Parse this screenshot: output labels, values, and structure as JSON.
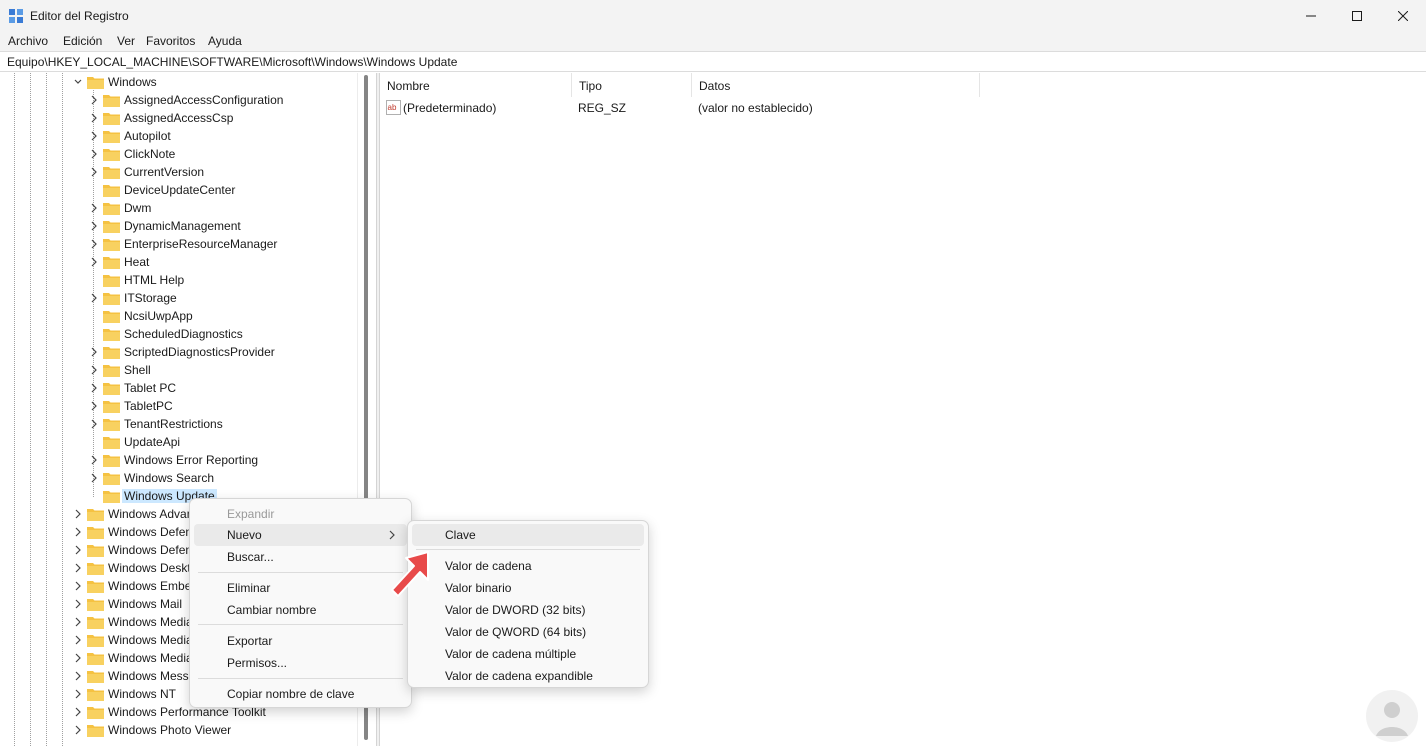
{
  "window": {
    "title": "Editor del Registro",
    "controls": [
      "minimize",
      "maximize",
      "close"
    ]
  },
  "menu": {
    "items": [
      "Archivo",
      "Edición",
      "Ver",
      "Favoritos",
      "Ayuda"
    ]
  },
  "address": {
    "path": "Equipo\\HKEY_LOCAL_MACHINE\\SOFTWARE\\Microsoft\\Windows\\Windows Update"
  },
  "tree": {
    "parent": "Windows",
    "children": [
      {
        "label": "AssignedAccessConfiguration",
        "expandable": true
      },
      {
        "label": "AssignedAccessCsp",
        "expandable": true
      },
      {
        "label": "Autopilot",
        "expandable": true
      },
      {
        "label": "ClickNote",
        "expandable": true
      },
      {
        "label": "CurrentVersion",
        "expandable": true
      },
      {
        "label": "DeviceUpdateCenter",
        "expandable": false
      },
      {
        "label": "Dwm",
        "expandable": true
      },
      {
        "label": "DynamicManagement",
        "expandable": true
      },
      {
        "label": "EnterpriseResourceManager",
        "expandable": true
      },
      {
        "label": "Heat",
        "expandable": true
      },
      {
        "label": "HTML Help",
        "expandable": false
      },
      {
        "label": "ITStorage",
        "expandable": true
      },
      {
        "label": "NcsiUwpApp",
        "expandable": false
      },
      {
        "label": "ScheduledDiagnostics",
        "expandable": false
      },
      {
        "label": "ScriptedDiagnosticsProvider",
        "expandable": true
      },
      {
        "label": "Shell",
        "expandable": true
      },
      {
        "label": "Tablet PC",
        "expandable": true
      },
      {
        "label": "TabletPC",
        "expandable": true
      },
      {
        "label": "TenantRestrictions",
        "expandable": true
      },
      {
        "label": "UpdateApi",
        "expandable": false
      },
      {
        "label": "Windows Error Reporting",
        "expandable": true
      },
      {
        "label": "Windows Search",
        "expandable": true
      },
      {
        "label": "Windows Update",
        "expandable": false,
        "selected": true
      }
    ],
    "siblings": [
      {
        "label": "Windows Advan"
      },
      {
        "label": "Windows Defen"
      },
      {
        "label": "Windows Defen"
      },
      {
        "label": "Windows Deskt"
      },
      {
        "label": "Windows Embe"
      },
      {
        "label": "Windows Mail"
      },
      {
        "label": "Windows Media"
      },
      {
        "label": "Windows Media"
      },
      {
        "label": "Windows Media"
      },
      {
        "label": "Windows Messa"
      },
      {
        "label": "Windows NT"
      },
      {
        "label": "Windows Performance Toolkit"
      },
      {
        "label": "Windows Photo Viewer"
      }
    ]
  },
  "list": {
    "columns": [
      "Nombre",
      "Tipo",
      "Datos"
    ],
    "rows": [
      {
        "name": "(Predeterminado)",
        "type": "REG_SZ",
        "data": "(valor no establecido)",
        "icon": "string-value-icon"
      }
    ]
  },
  "context_menu": {
    "items": [
      {
        "label": "Expandir",
        "disabled": true
      },
      {
        "label": "Nuevo",
        "submenu": true,
        "highlighted": true
      },
      {
        "label": "Buscar..."
      },
      {
        "label": "Eliminar"
      },
      {
        "label": "Cambiar nombre"
      },
      {
        "label": "Exportar"
      },
      {
        "label": "Permisos..."
      },
      {
        "label": "Copiar nombre de clave"
      }
    ]
  },
  "submenu": {
    "items": [
      {
        "label": "Clave",
        "highlighted": true
      },
      {
        "label": "Valor de cadena"
      },
      {
        "label": "Valor binario"
      },
      {
        "label": "Valor de DWORD (32 bits)"
      },
      {
        "label": "Valor de QWORD (64 bits)"
      },
      {
        "label": "Valor de cadena múltiple"
      },
      {
        "label": "Valor de cadena expandible"
      }
    ]
  },
  "colors": {
    "titlebar_bg": "#f3f3f3",
    "selection": "#cce8ff",
    "folder": "#f5c242",
    "pointer_arrow": "#e84a4a"
  }
}
